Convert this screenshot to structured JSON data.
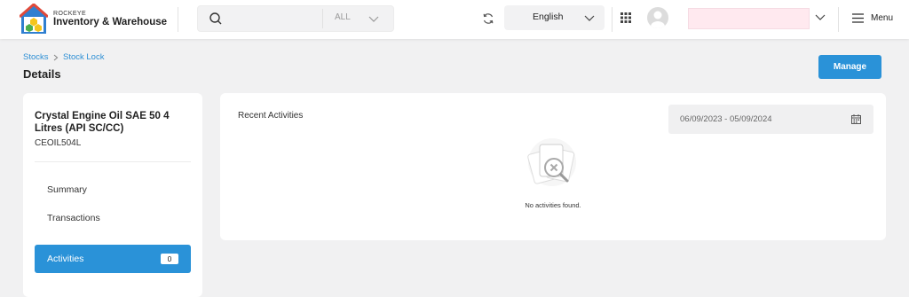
{
  "brand": {
    "small": "ROCKEYE",
    "name": "Inventory & Warehouse"
  },
  "search": {
    "scope": "ALL"
  },
  "language": {
    "selected": "English"
  },
  "menu": {
    "label": "Menu"
  },
  "breadcrumb": [
    "Stocks",
    "Stock Lock"
  ],
  "page": {
    "title": "Details",
    "manage_label": "Manage"
  },
  "product": {
    "name": "Crystal Engine Oil SAE 50 4 Litres (API SC/CC)",
    "code": "CEOIL504L"
  },
  "nav": {
    "summary": "Summary",
    "transactions": "Transactions",
    "activities": "Activities",
    "activities_count": "0"
  },
  "activities": {
    "title": "Recent Activities",
    "date_range": "06/09/2023 - 05/09/2024",
    "empty": "No activities found."
  },
  "colors": {
    "accent": "#2a92d8",
    "logo_red": "#e04a3b",
    "logo_blue": "#2f7fd0",
    "logo_yellow": "#f5c51b",
    "logo_green": "#4cae4c"
  }
}
